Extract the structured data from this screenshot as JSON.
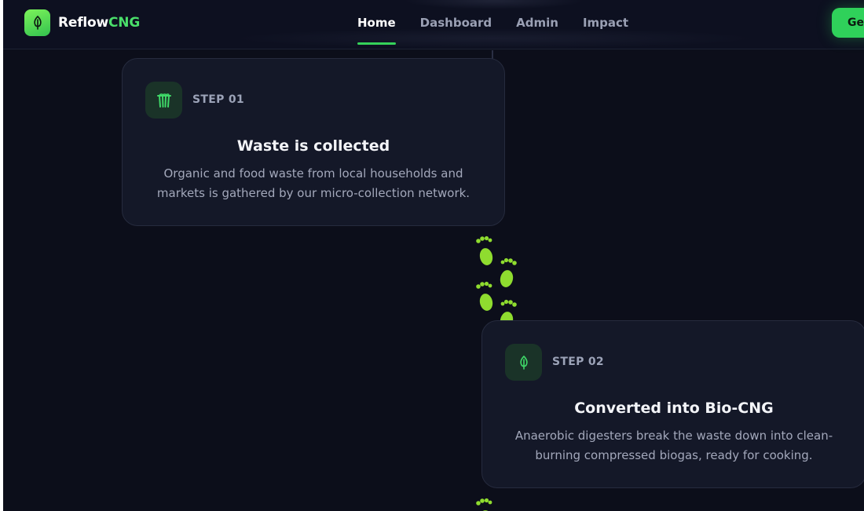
{
  "brand": {
    "name_part1": "Reflow",
    "name_part2": "CNG",
    "icon": "leaf-icon"
  },
  "nav": {
    "links": [
      {
        "label": "Home",
        "active": true
      },
      {
        "label": "Dashboard",
        "active": false
      },
      {
        "label": "Admin",
        "active": false
      },
      {
        "label": "Impact",
        "active": false
      }
    ],
    "cta_label": "Ge"
  },
  "steps": [
    {
      "step_label": "STEP 01",
      "icon": "trash-bin-icon",
      "title": "Waste is collected",
      "description": "Organic and food waste from local households and markets is gathered by our micro-collection network."
    },
    {
      "step_label": "STEP 02",
      "icon": "leaf-icon",
      "title": "Converted into Bio-CNG",
      "description": "Anaerobic digesters break the waste down into clean-burning compressed biogas, ready for cooking."
    }
  ],
  "colors": {
    "background": "#0c0e1a",
    "accent": "#35d25a",
    "footprint": "#8fdc2f",
    "card": "#141828"
  }
}
